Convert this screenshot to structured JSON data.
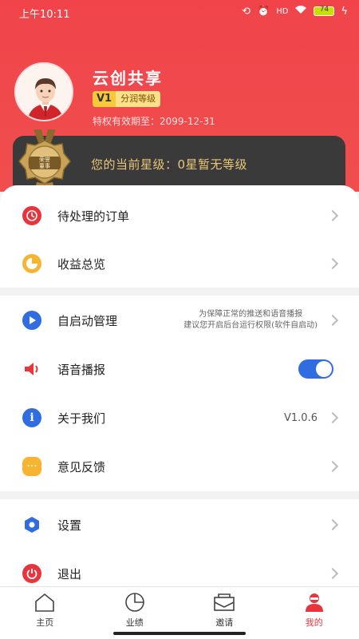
{
  "status_bar": {
    "time": "上午10:11",
    "battery": "74"
  },
  "profile": {
    "name": "云创共享",
    "vip_level": "V1",
    "vip_text": "分润等级",
    "expiry": "特权有效期至：2099-12-31"
  },
  "star_card": {
    "medal_text": "荣誉董事",
    "text": "您的当前星级：0星暂无等级"
  },
  "menu": {
    "pending_orders": "待处理的订单",
    "earnings": "收益总览",
    "autostart": "自启动管理",
    "autostart_note_1": "为保障正常的推送和语音播报",
    "autostart_note_2": "建议您开启后台运行权限(软件自启动)",
    "voice": "语音播报",
    "voice_enabled": true,
    "about": "关于我们",
    "version": "V1.0.6",
    "feedback": "意见反馈",
    "settings": "设置",
    "logout": "退出"
  },
  "colors": {
    "brand_red": "#f0444a",
    "toggle_blue": "#2f6de1",
    "gold": "#e9c77a"
  },
  "tabs": [
    {
      "label": "主页",
      "icon": "home-icon",
      "active": false
    },
    {
      "label": "业绩",
      "icon": "pie-chart-icon",
      "active": false
    },
    {
      "label": "邀请",
      "icon": "envelope-icon",
      "active": false
    },
    {
      "label": "我的",
      "icon": "user-icon",
      "active": true
    }
  ]
}
